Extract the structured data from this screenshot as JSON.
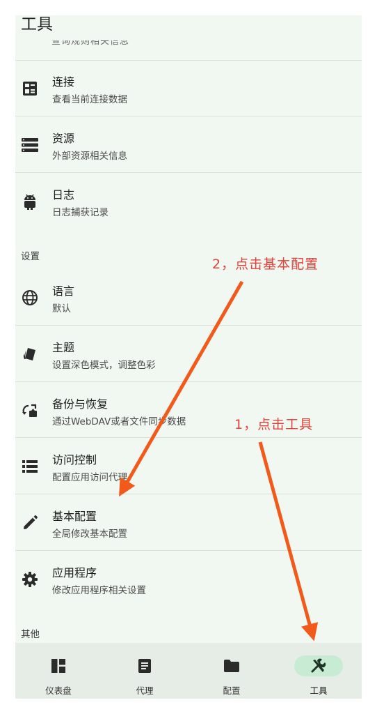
{
  "header": {
    "title": "工具",
    "clipped_subtitle": "查询规则相关信息"
  },
  "tools_items": [
    {
      "icon": "connections-icon",
      "title": "连接",
      "subtitle": "查看当前连接数据"
    },
    {
      "icon": "resources-icon",
      "title": "资源",
      "subtitle": "外部资源相关信息"
    },
    {
      "icon": "android-icon",
      "title": "日志",
      "subtitle": "日志捕获记录"
    }
  ],
  "sections": {
    "settings": "设置",
    "other": "其他"
  },
  "settings_items": [
    {
      "icon": "globe-icon",
      "title": "语言",
      "subtitle": "默认"
    },
    {
      "icon": "theme-icon",
      "title": "主题",
      "subtitle": "设置深色模式，调整色彩"
    },
    {
      "icon": "backup-restore-icon",
      "title": "备份与恢复",
      "subtitle": "通过WebDAV或者文件同步数据"
    },
    {
      "icon": "list-icon",
      "title": "访问控制",
      "subtitle": "配置应用访问代理"
    },
    {
      "icon": "pencil-icon",
      "title": "基本配置",
      "subtitle": "全局修改基本配置"
    },
    {
      "icon": "gear-icon",
      "title": "应用程序",
      "subtitle": "修改应用程序相关设置"
    }
  ],
  "bottom_nav": [
    {
      "icon": "dashboard-icon",
      "label": "仪表盘",
      "active": false
    },
    {
      "icon": "proxy-icon",
      "label": "代理",
      "active": false
    },
    {
      "icon": "folder-icon",
      "label": "配置",
      "active": false
    },
    {
      "icon": "tools-icon",
      "label": "工具",
      "active": true
    }
  ],
  "annotations": {
    "step1": "1，点击工具",
    "step2": "2，点击基本配置",
    "color": "#e5413a",
    "arrow_color": "#f25a1c"
  },
  "colors": {
    "background": "#f1f8f1",
    "nav_background": "#e6ede6",
    "active_pill": "#c7ecd3"
  }
}
